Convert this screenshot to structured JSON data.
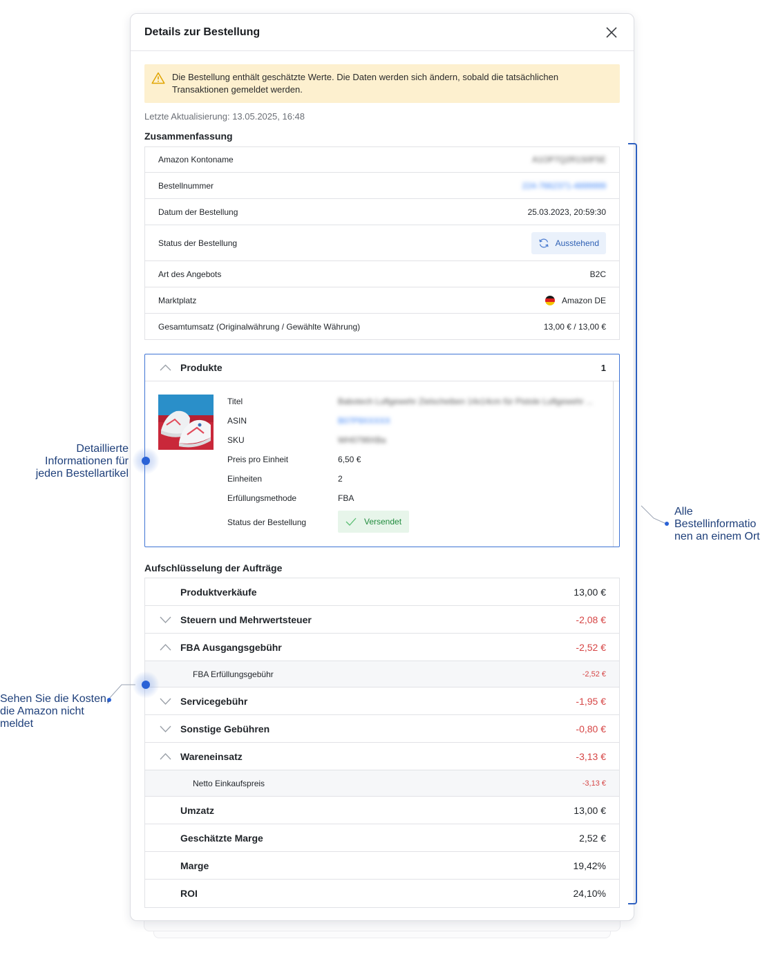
{
  "dialog": {
    "title": "Details zur Bestellung",
    "warning_text": "Die Bestellung enthält geschätzte Werte. Die Daten werden sich ändern, sobald die tatsächlichen Transaktionen gemeldet werden.",
    "updated": "Letzte Aktualisierung: 13.05.2025, 16:48"
  },
  "summary": {
    "title": "Zusammenfassung",
    "rows": [
      {
        "label": "Amazon Kontoname",
        "value": "A1OP7Q2R1S0F5E"
      },
      {
        "label": "Bestellnummer",
        "value": "224-7662371-4899999"
      },
      {
        "label": "Datum der Bestellung",
        "value": "25.03.2023, 20:59:30"
      },
      {
        "label": "Status der Bestellung",
        "value": "Ausstehend"
      },
      {
        "label": "Art des Angebots",
        "value": "B2C"
      },
      {
        "label": "Marktplatz",
        "value": "Amazon DE"
      },
      {
        "label": "Gesamtumsatz (Originalwährung / Gewählte Währung)",
        "value": "13,00 € / 13,00 €"
      }
    ],
    "colors": {
      "pending_bg": "#eaf1fb",
      "pending_text": "#2d5fb3"
    }
  },
  "products": {
    "label": "Produkte",
    "count": "1",
    "fields": [
      {
        "label": "Titel",
        "value": "Babotech Luftgewehr Zielscheiben 14x14cm für Pistole Luftgewehr ..."
      },
      {
        "label": "ASIN",
        "value": "B07P9XXXXX"
      },
      {
        "label": "SKU",
        "value": "WH0799XBa"
      },
      {
        "label": "Preis pro Einheit",
        "value": "6,50 €"
      },
      {
        "label": "Einheiten",
        "value": "2"
      },
      {
        "label": "Erfüllungsmethode",
        "value": "FBA"
      },
      {
        "label": "Status der Bestellung",
        "value": "Versendet"
      }
    ]
  },
  "breakdown": {
    "title": "Aufschlüsselung der Aufträge",
    "rows": [
      {
        "label": "Produktverkäufe",
        "value": "13,00 €"
      },
      {
        "label": "Steuern und Mehrwertsteuer",
        "value": "-2,08 €"
      },
      {
        "label": "FBA Ausgangsgebühr",
        "value": "-2,52 €"
      },
      {
        "label": "FBA Erfüllungsgebühr",
        "value": "-2,52 €"
      },
      {
        "label": "Servicegebühr",
        "value": "-1,95 €"
      },
      {
        "label": "Sonstige Gebühren",
        "value": "-0,80 €"
      },
      {
        "label": "Wareneinsatz",
        "value": "-3,13 €"
      },
      {
        "label": "Netto Einkaufspreis",
        "value": "-3,13 €"
      },
      {
        "label": "Umzatz",
        "value": "13,00 €"
      },
      {
        "label": "Geschätzte Marge",
        "value": "2,52 €"
      },
      {
        "label": "Marge",
        "value": "19,42%"
      },
      {
        "label": "ROI",
        "value": "24,10%"
      }
    ],
    "colors": {
      "negative": "#d64545"
    }
  },
  "annotations": {
    "left_top": [
      "Detaillierte",
      "Informationen für",
      "jeden Bestellartikel"
    ],
    "right": [
      "Alle",
      "Bestellinformatio",
      "nen an einem Ort"
    ],
    "left_bottom": [
      "Sehen Sie die Kosten,",
      "die Amazon nicht",
      "meldet"
    ]
  },
  "icons": {
    "close": "close-icon",
    "warning": "warning-icon",
    "pending": "refresh-icon",
    "sent": "check-icon",
    "flag": "germany-flag-icon"
  }
}
